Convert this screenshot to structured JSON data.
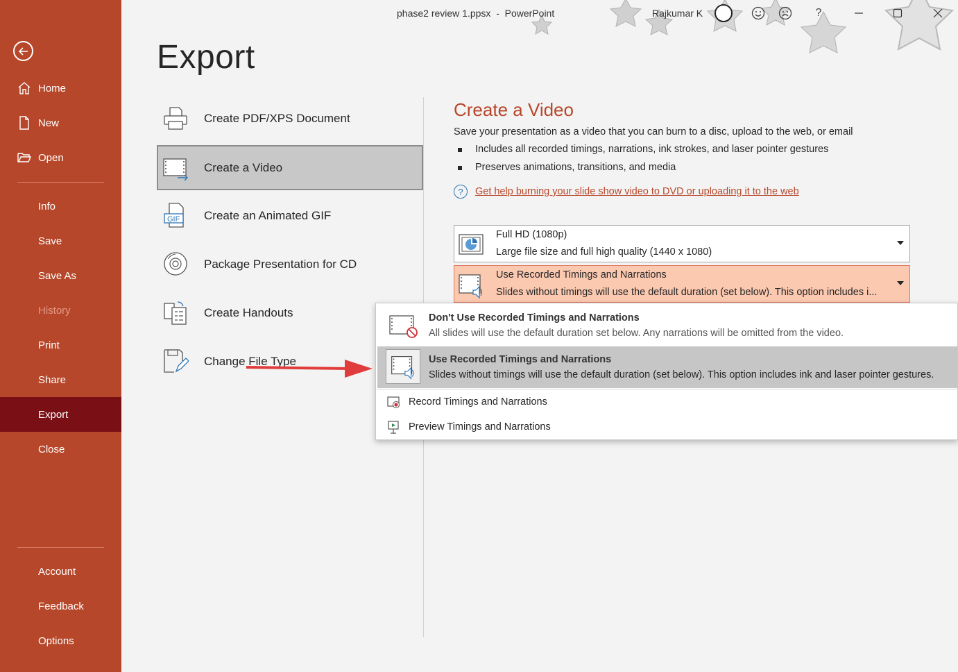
{
  "window": {
    "title": "phase2 review 1.ppsx  -  PowerPoint",
    "user": "Rajkumar K",
    "help": "?"
  },
  "sidebar": {
    "items": [
      {
        "label": "Home",
        "icon": "home-icon"
      },
      {
        "label": "New",
        "icon": "new-document-icon"
      },
      {
        "label": "Open",
        "icon": "folder-open-icon"
      },
      {
        "label": "Info"
      },
      {
        "label": "Save"
      },
      {
        "label": "Save As"
      },
      {
        "label": "History"
      },
      {
        "label": "Print"
      },
      {
        "label": "Share"
      },
      {
        "label": "Export"
      },
      {
        "label": "Close"
      },
      {
        "label": "Account"
      },
      {
        "label": "Feedback"
      },
      {
        "label": "Options"
      }
    ],
    "active": "Export",
    "disabled": "History"
  },
  "main": {
    "title": "Export",
    "options": [
      {
        "label": "Create PDF/XPS Document",
        "icon": "pdf-printer-icon"
      },
      {
        "label": "Create a Video",
        "icon": "video-export-icon",
        "selected": true
      },
      {
        "label": "Create an Animated GIF",
        "icon": "gif-icon"
      },
      {
        "label": "Package Presentation for CD",
        "icon": "cd-icon"
      },
      {
        "label": "Create Handouts",
        "icon": "handouts-icon"
      },
      {
        "label": "Change File Type",
        "icon": "change-file-type-icon"
      }
    ]
  },
  "video_panel": {
    "title": "Create a Video",
    "description": "Save your presentation as a video that you can burn to a disc, upload to the web, or email",
    "bullets": [
      "Includes all recorded timings, narrations, ink strokes, and laser pointer gestures",
      "Preserves animations, transitions, and media"
    ],
    "help_link": "Get help burning your slide show video to DVD or uploading it to the web",
    "quality_dropdown": {
      "title": "Full HD (1080p)",
      "subtitle": "Large file size and full high quality (1440 x 1080)"
    },
    "timings_dropdown": {
      "title": "Use Recorded Timings and Narrations",
      "subtitle": "Slides without timings will use the default duration (set below). This option includes i..."
    },
    "menu": {
      "items": [
        {
          "title": "Don't Use Recorded Timings and Narrations",
          "desc": "All slides will use the default duration set below. Any narrations will be omitted from the video."
        },
        {
          "title": "Use Recorded Timings and Narrations",
          "desc": "Slides without timings will use the default duration (set below). This option includes ink and laser pointer gestures."
        }
      ],
      "actions": [
        {
          "label": "Record Timings and Narrations"
        },
        {
          "label": "Preview Timings and Narrations"
        }
      ]
    }
  },
  "colors": {
    "sidebar": "#b7472a",
    "sidebar_active": "#7a1016",
    "accent": "#b7472a",
    "annotation_arrow": "#e03c3c"
  }
}
